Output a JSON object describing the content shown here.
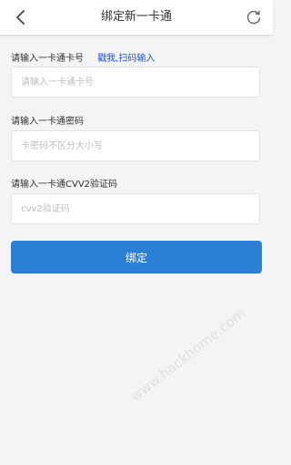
{
  "header": {
    "title": "绑定新一卡通",
    "back_icon": "chevron-left-icon",
    "refresh_icon": "refresh-icon"
  },
  "form": {
    "card_number": {
      "label": "请输入一卡通卡号",
      "scan_link": "戳我,扫码输入",
      "placeholder": "请输入一卡通卡号",
      "value": ""
    },
    "password": {
      "label": "请输入一卡通密码",
      "placeholder": "卡密码不区分大小写",
      "value": ""
    },
    "cvv": {
      "label": "请输入一卡通CVV2验证码",
      "placeholder": "cvv2验证码",
      "value": ""
    },
    "submit_label": "绑定"
  },
  "watermark": {
    "text": "www.hackhome.com"
  },
  "colors": {
    "accent": "#2b7fd6",
    "link": "#2352c8",
    "background": "#f4f4f4"
  }
}
